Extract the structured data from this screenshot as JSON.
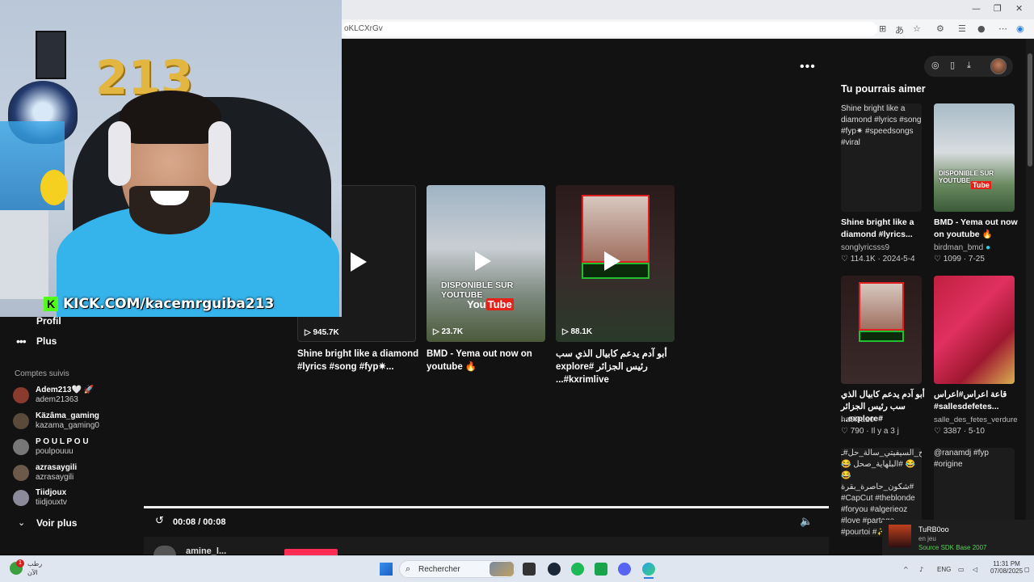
{
  "browser": {
    "url_fragment": "oKLCXrGv"
  },
  "page": {
    "sidebar": {
      "partial_item": "Profil",
      "more_label": "Plus",
      "following_heading": "Comptes suivis",
      "followed": [
        {
          "name": "Adem213🤍 🚀",
          "handle": "adem21363",
          "color": "#8b3b2e"
        },
        {
          "name": "Käzâma_gaming",
          "handle": "kazama_gaming0",
          "color": "#5a4a3a"
        },
        {
          "name": "P O U L P O U",
          "handle": "poulpouuu",
          "color": "#777777"
        },
        {
          "name": "azrasaygili",
          "handle": "azrasaygili",
          "color": "#6b5a4a"
        },
        {
          "name": "Tiidjoux",
          "handle": "tiidjouxtv",
          "color": "#8a8a9a"
        }
      ],
      "see_more": "Voir plus"
    },
    "feed": [
      {
        "views": "945.7K",
        "title": "Shine bright like a diamond #lyrics #song #fyp✷..."
      },
      {
        "views": "23.7K",
        "title": "BMD - Yema out now on youtube 🔥",
        "overlay_top": "DISPONIBLE SUR YOUTUBE",
        "overlay_you": "You",
        "overlay_tube": "Tube"
      },
      {
        "views": "88.1K",
        "title": "أبو آدم يدعم كابيال الذي سب رئيس الجزائر #explore #kxrimlive..."
      }
    ],
    "recommendations": {
      "heading": "Tu pourrais aimer",
      "items": [
        {
          "alt": "Shine bright like a diamond #lyrics #song #fyp✷ #speedsongs #viral",
          "title": "Shine bright like a diamond #lyrics...",
          "author": "songlyricsss9",
          "likes": "114.1K",
          "date": "2024-5-4"
        },
        {
          "alt": "",
          "title": "BMD - Yema out now on youtube 🔥",
          "author": "birdman_bmd",
          "likes": "1099",
          "date": "7-25",
          "overlay": "DISPONIBLE SUR YOUTUBE"
        },
        {
          "alt": "",
          "title": "أبو آدم يدعم كابيال الذي سب رئيس الجزائر #explore...",
          "author": "ha9i9a10",
          "likes": "790",
          "date": "Il y a 3 j"
        },
        {
          "alt": "",
          "title": "قاعة اعراس#اعراس #sallesdefetes...",
          "author": "salle_des_fetes_verdure",
          "likes": "3387",
          "date": "5-10"
        },
        {
          "alt": "التصحيح_السيفيتي_سالة_حل#ـ 😂 #البلهاية_صحل 😂😂 #شكون_حاصرة_بقرة #CapCut #theblonde #foryou #algerieoz #love #partage #pourtoi #✨..."
        },
        {
          "alt": "@ranamdj #fyp #origine"
        }
      ]
    },
    "player": {
      "time": "00:08 / 00:08",
      "progress": 1.0,
      "comment_author": "amine_l..."
    }
  },
  "overlay": {
    "kick_url": "KICK.COM/kacemrguiba213",
    "balloon_text": "213"
  },
  "notification": {
    "name": "TuRB0oo",
    "status": "en jeu",
    "game": "Source SDK Base 2007"
  },
  "taskbar": {
    "weather_line1": "رطب",
    "weather_line2": "الآن",
    "search_placeholder": "Rechercher",
    "lang": "ENG",
    "time": "11:31 PM",
    "date": "07/08/2025",
    "badge_count": "1"
  }
}
